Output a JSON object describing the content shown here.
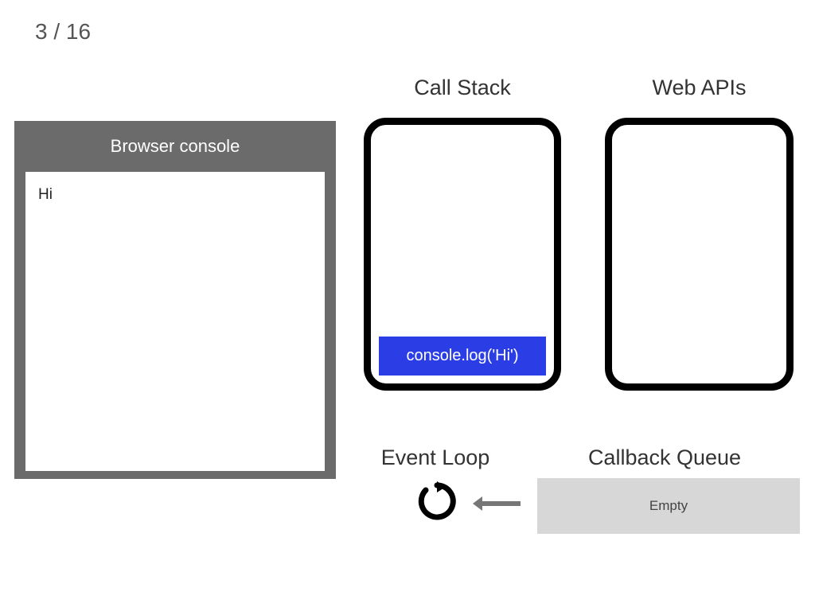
{
  "slide": {
    "current": 3,
    "total": 16,
    "display": "3 / 16"
  },
  "headings": {
    "callStack": "Call Stack",
    "webApis": "Web APIs",
    "eventLoop": "Event Loop",
    "callbackQueue": "Callback Queue"
  },
  "console": {
    "title": "Browser console",
    "output": [
      "Hi"
    ]
  },
  "callStack": {
    "items": [
      "console.log('Hi')"
    ]
  },
  "webApis": {
    "items": []
  },
  "callbackQueue": {
    "status": "Empty",
    "items": []
  },
  "colors": {
    "stackItemBg": "#2b3ee6",
    "consoleFrame": "#6b6b6b",
    "queueBg": "#d7d7d7"
  }
}
